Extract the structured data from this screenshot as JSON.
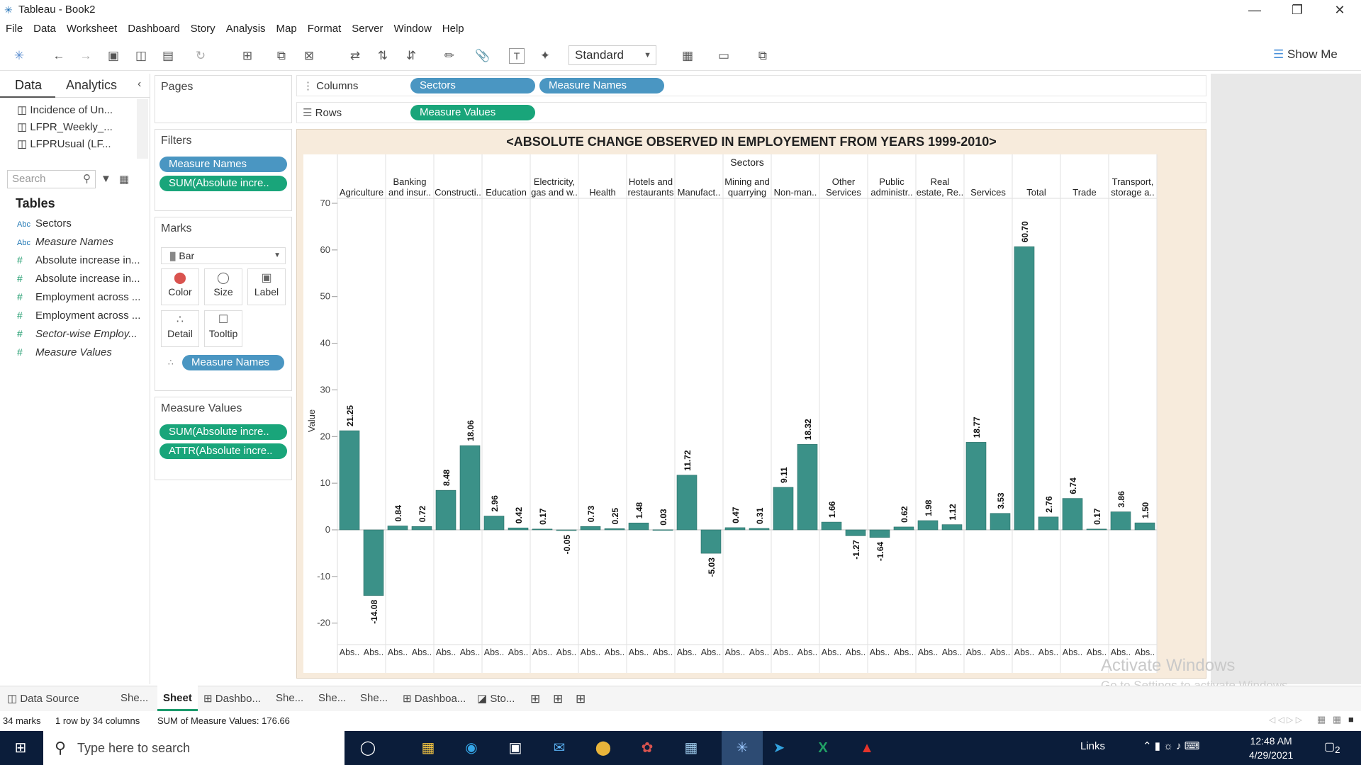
{
  "window": {
    "title": "Tableau - Book2"
  },
  "menu": [
    "File",
    "Data",
    "Worksheet",
    "Dashboard",
    "Story",
    "Analysis",
    "Map",
    "Format",
    "Server",
    "Window",
    "Help"
  ],
  "toolbar": {
    "fit_select": "Standard",
    "show_me": "Show Me"
  },
  "left_pane": {
    "tabs": {
      "data": "Data",
      "analytics": "Analytics"
    },
    "data_sources": [
      "Incidence of Un...",
      "LFPR_Weekly_...",
      "LFPRUsual (LF..."
    ],
    "search_placeholder": "Search",
    "tables_heading": "Tables",
    "fields": [
      {
        "type": "Abc",
        "name": "Sectors",
        "italic": false
      },
      {
        "type": "Abc",
        "name": "Measure Names",
        "italic": true
      },
      {
        "type": "#",
        "name": "Absolute increase in...",
        "italic": false
      },
      {
        "type": "#",
        "name": "Absolute increase in...",
        "italic": false
      },
      {
        "type": "#",
        "name": "Employment across ...",
        "italic": false
      },
      {
        "type": "#",
        "name": "Employment across ...",
        "italic": false
      },
      {
        "type": "#",
        "name": "Sector-wise Employ...",
        "italic": true
      },
      {
        "type": "#",
        "name": "Measure Values",
        "italic": true
      }
    ]
  },
  "cards": {
    "pages": "Pages",
    "filters": {
      "title": "Filters",
      "pills": [
        "Measure Names",
        "SUM(Absolute incre.."
      ]
    },
    "marks": {
      "title": "Marks",
      "type": "Bar",
      "buttons": [
        "Color",
        "Size",
        "Label",
        "Detail",
        "Tooltip"
      ],
      "pill": "Measure Names"
    },
    "measure_values": {
      "title": "Measure Values",
      "pills": [
        "SUM(Absolute incre..",
        "ATTR(Absolute incre.."
      ]
    }
  },
  "shelves": {
    "columns_label": "Columns",
    "columns_pills": [
      "Sectors",
      "Measure Names"
    ],
    "rows_label": "Rows",
    "rows_pills": [
      "Measure Values"
    ]
  },
  "chart_data": {
    "type": "bar",
    "title": "<ABSOLUTE CHANGE OBSERVED IN EMPLOYEMENT FROM YEARS 1999-2010>",
    "header": "Sectors",
    "ylabel": "Value",
    "ylim": [
      -25,
      70
    ],
    "yticks": [
      70,
      60,
      50,
      40,
      30,
      20,
      10,
      0,
      -10,
      -20
    ],
    "color": "#3b9188",
    "bottom_label": "Abs..",
    "sectors": [
      {
        "label": [
          "Agriculture"
        ],
        "values": [
          21.25,
          -14.08
        ]
      },
      {
        "label": [
          "Banking",
          "and insur.."
        ],
        "values": [
          0.84,
          0.72
        ]
      },
      {
        "label": [
          "Constructi.."
        ],
        "values": [
          8.48,
          18.06
        ]
      },
      {
        "label": [
          "Education"
        ],
        "values": [
          2.96,
          0.42
        ]
      },
      {
        "label": [
          "Electricity,",
          "gas and w.."
        ],
        "values": [
          0.17,
          -0.05
        ]
      },
      {
        "label": [
          "Health"
        ],
        "values": [
          0.73,
          0.25
        ]
      },
      {
        "label": [
          "Hotels and",
          "restaurants"
        ],
        "values": [
          1.48,
          0.03
        ]
      },
      {
        "label": [
          "Manufact.."
        ],
        "values": [
          11.72,
          -5.03
        ]
      },
      {
        "label": [
          "Mining and",
          "quarrying"
        ],
        "values": [
          0.47,
          0.31
        ]
      },
      {
        "label": [
          "Non-man.."
        ],
        "values": [
          9.11,
          18.32
        ]
      },
      {
        "label": [
          "Other",
          "Services"
        ],
        "values": [
          1.66,
          -1.27
        ]
      },
      {
        "label": [
          "Public",
          "administr.."
        ],
        "values": [
          -1.64,
          0.62
        ]
      },
      {
        "label": [
          "Real",
          "estate, Re.."
        ],
        "values": [
          1.98,
          1.12
        ]
      },
      {
        "label": [
          "Services"
        ],
        "values": [
          18.77,
          3.53
        ]
      },
      {
        "label": [
          "Total"
        ],
        "values": [
          60.7,
          2.76
        ]
      },
      {
        "label": [
          "Trade"
        ],
        "values": [
          6.74,
          0.17
        ]
      },
      {
        "label": [
          "Transport,",
          "storage a.."
        ],
        "values": [
          3.86,
          1.5
        ]
      }
    ]
  },
  "sheet_tabs": [
    "Data Source",
    "She...",
    "Sheet",
    "Dashbo...",
    "She...",
    "She...",
    "She...",
    "Dashboa...",
    "Sto..."
  ],
  "status": {
    "marks": "34 marks",
    "layout": "1 row by 34 columns",
    "sum": "SUM of Measure Values: 176.66"
  },
  "watermark": {
    "line1": "Activate Windows",
    "line2": "Go to Settings to activate Windows."
  },
  "taskbar": {
    "search": "Type here to search",
    "links": "Links",
    "time": "12:48 AM",
    "date": "4/29/2021",
    "notif": "2"
  }
}
